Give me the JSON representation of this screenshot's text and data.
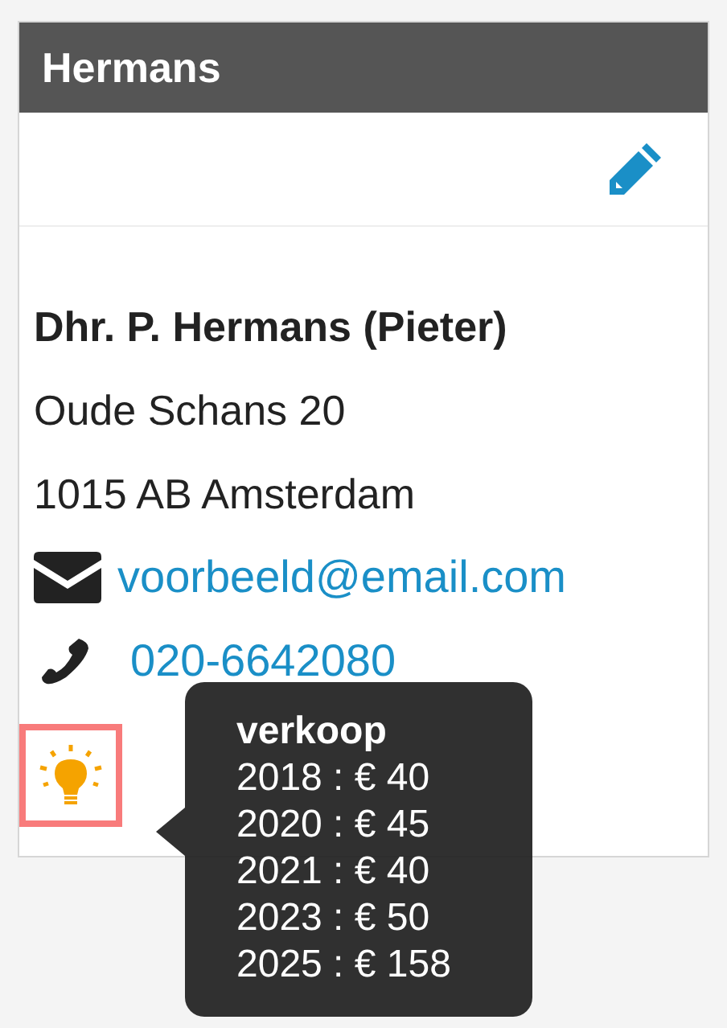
{
  "card": {
    "title": "Hermans"
  },
  "contact": {
    "name": "Dhr. P. Hermans (Pieter)",
    "address_lines": [
      "Oude Schans 20",
      "1015 AB Amsterdam"
    ],
    "email": "voorbeeld@email.com",
    "phone": "020-6642080"
  },
  "hint": {
    "focused": true,
    "tooltip": {
      "title": "verkoop",
      "lines": [
        "2018 : € 40",
        "2020 : € 45",
        "2021 : € 40",
        "2023 : € 50",
        "2025 : € 158"
      ]
    }
  }
}
